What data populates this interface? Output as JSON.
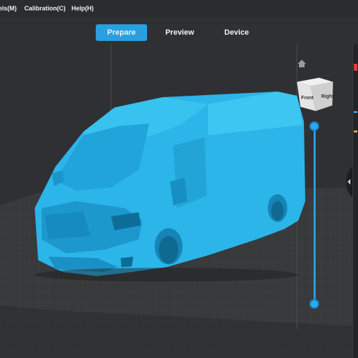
{
  "menu": {
    "items": [
      {
        "label": "els(M)"
      },
      {
        "label": "Calibration(C)"
      },
      {
        "label": "Help(H)"
      }
    ]
  },
  "tabs": [
    {
      "label": "Prepare",
      "active": true
    },
    {
      "label": "Preview",
      "active": false
    },
    {
      "label": "Device",
      "active": false
    }
  ],
  "view_cube": {
    "front_label": "Front",
    "right_label": "Right"
  },
  "icons": {
    "home": "home-icon",
    "collapse": "chevron-left-icon"
  },
  "colors": {
    "accent": "#2a9fe0",
    "model": "#2bb5e8",
    "plate": "#3a3a3c",
    "background": "#2f3033"
  }
}
